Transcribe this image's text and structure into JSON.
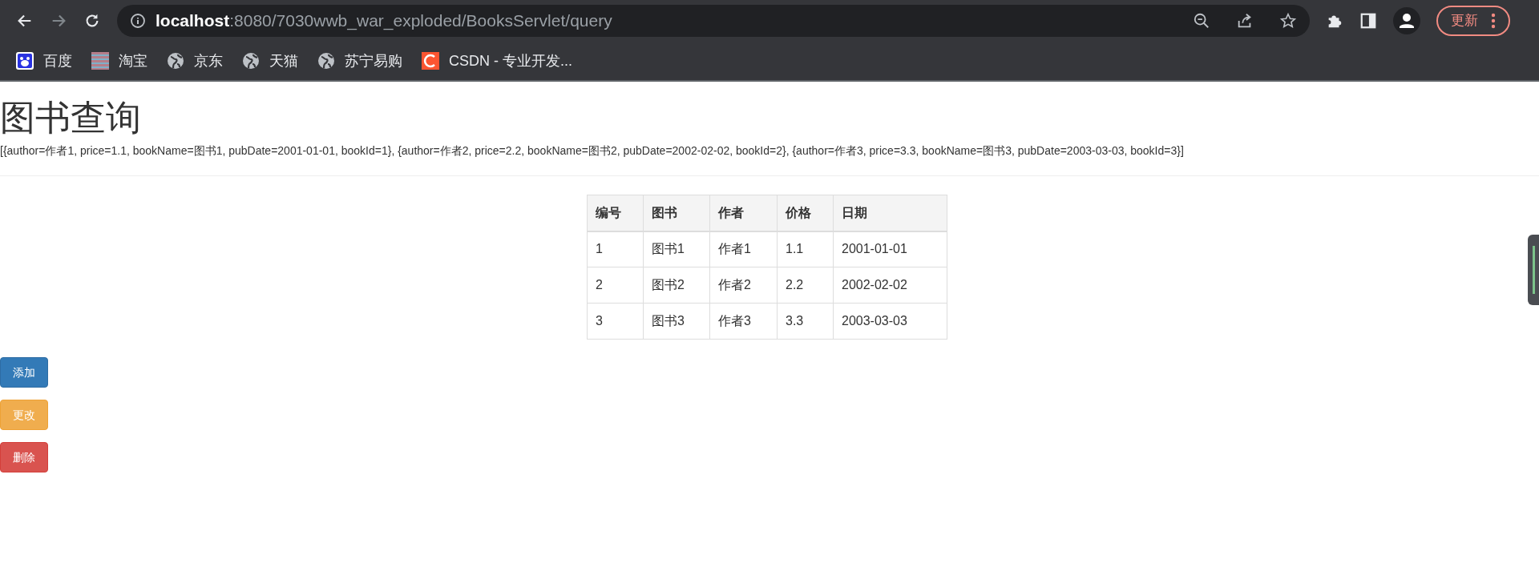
{
  "browser": {
    "url_host": "localhost",
    "url_path": ":8080/7030wwb_war_exploded/BooksServlet/query",
    "update_button": "更新",
    "bookmarks": [
      {
        "kind": "baidu",
        "label": "百度"
      },
      {
        "kind": "taobao",
        "label": "淘宝"
      },
      {
        "kind": "globe",
        "label": "京东"
      },
      {
        "kind": "globe",
        "label": "天猫"
      },
      {
        "kind": "globe",
        "label": "苏宁易购"
      },
      {
        "kind": "csdn",
        "label": "CSDN - 专业开发..."
      }
    ]
  },
  "page": {
    "title": "图书查询",
    "raw_data": "[{author=作者1, price=1.1, bookName=图书1, pubDate=2001-01-01, bookId=1}, {author=作者2, price=2.2, bookName=图书2, pubDate=2002-02-02, bookId=2}, {author=作者3, price=3.3, bookName=图书3, pubDate=2003-03-03, bookId=3}]",
    "table": {
      "columns": [
        "编号",
        "图书",
        "作者",
        "价格",
        "日期"
      ],
      "rows": [
        [
          "1",
          "图书1",
          "作者1",
          "1.1",
          "2001-01-01"
        ],
        [
          "2",
          "图书2",
          "作者2",
          "2.2",
          "2002-02-02"
        ],
        [
          "3",
          "图书3",
          "作者3",
          "3.3",
          "2003-03-03"
        ]
      ]
    },
    "buttons": [
      {
        "kind": "primary",
        "label": "添加"
      },
      {
        "kind": "warning",
        "label": "更改"
      },
      {
        "kind": "danger",
        "label": "删除"
      }
    ]
  }
}
